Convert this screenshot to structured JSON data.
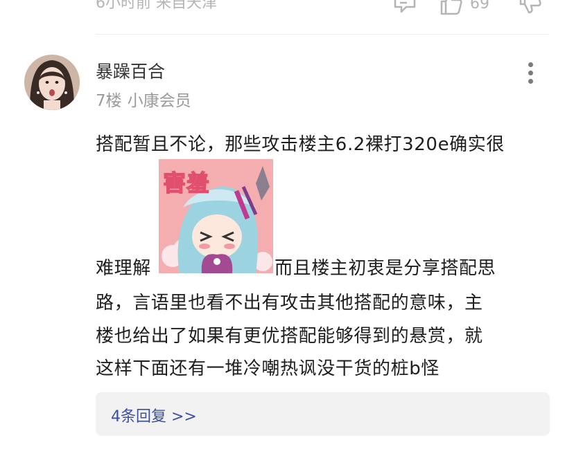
{
  "previous_post": {
    "meta": "6小时前 来自天津",
    "like_count": "69",
    "icons": [
      "comment-icon",
      "thumbs-up-icon",
      "thumbs-down-icon"
    ]
  },
  "comment": {
    "author": "暴躁百合",
    "floor": "7楼",
    "badge": "小康会员",
    "more_icon": "more-vertical-icon",
    "lines": {
      "line1": "搭配暂且不论，那些攻击楼主6.2裸打320e确实很",
      "line2a": "难理解",
      "line2b": "而且楼主初衷是分享搭配思",
      "line3": "路，言语里也看不出有攻击其他搭配的意味，主",
      "line4": "楼也给出了如果有更优搭配能够得到的悬赏，就",
      "line5": "这样下面还有一堆冷嘲热讽没干货的桩b怪"
    },
    "sticker": {
      "label": "害羞"
    },
    "reply_link": "4条回复 >>"
  },
  "colors": {
    "meta_gray": "#9a9a9a",
    "link_blue": "#3b4fa0",
    "reply_bg": "#f2f2f2",
    "sticker_bg": "#f5aeb0"
  }
}
